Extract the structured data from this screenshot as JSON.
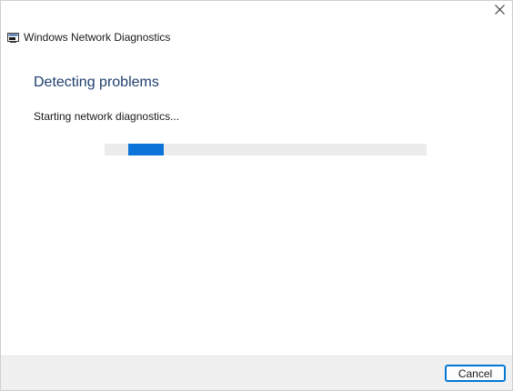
{
  "window": {
    "title": "Windows Network Diagnostics",
    "close_icon": "close-icon",
    "app_icon": "network-diagnostics-icon"
  },
  "main": {
    "heading": "Detecting problems",
    "status": "Starting network diagnostics...",
    "progress": {
      "mode": "indeterminate",
      "accent_color": "#0c74d8",
      "track_color": "#ececec"
    }
  },
  "footer": {
    "cancel_label": "Cancel"
  },
  "colors": {
    "heading": "#1e3e6e",
    "footer_bg": "#f0f0f0",
    "button_border": "#0078d4"
  }
}
